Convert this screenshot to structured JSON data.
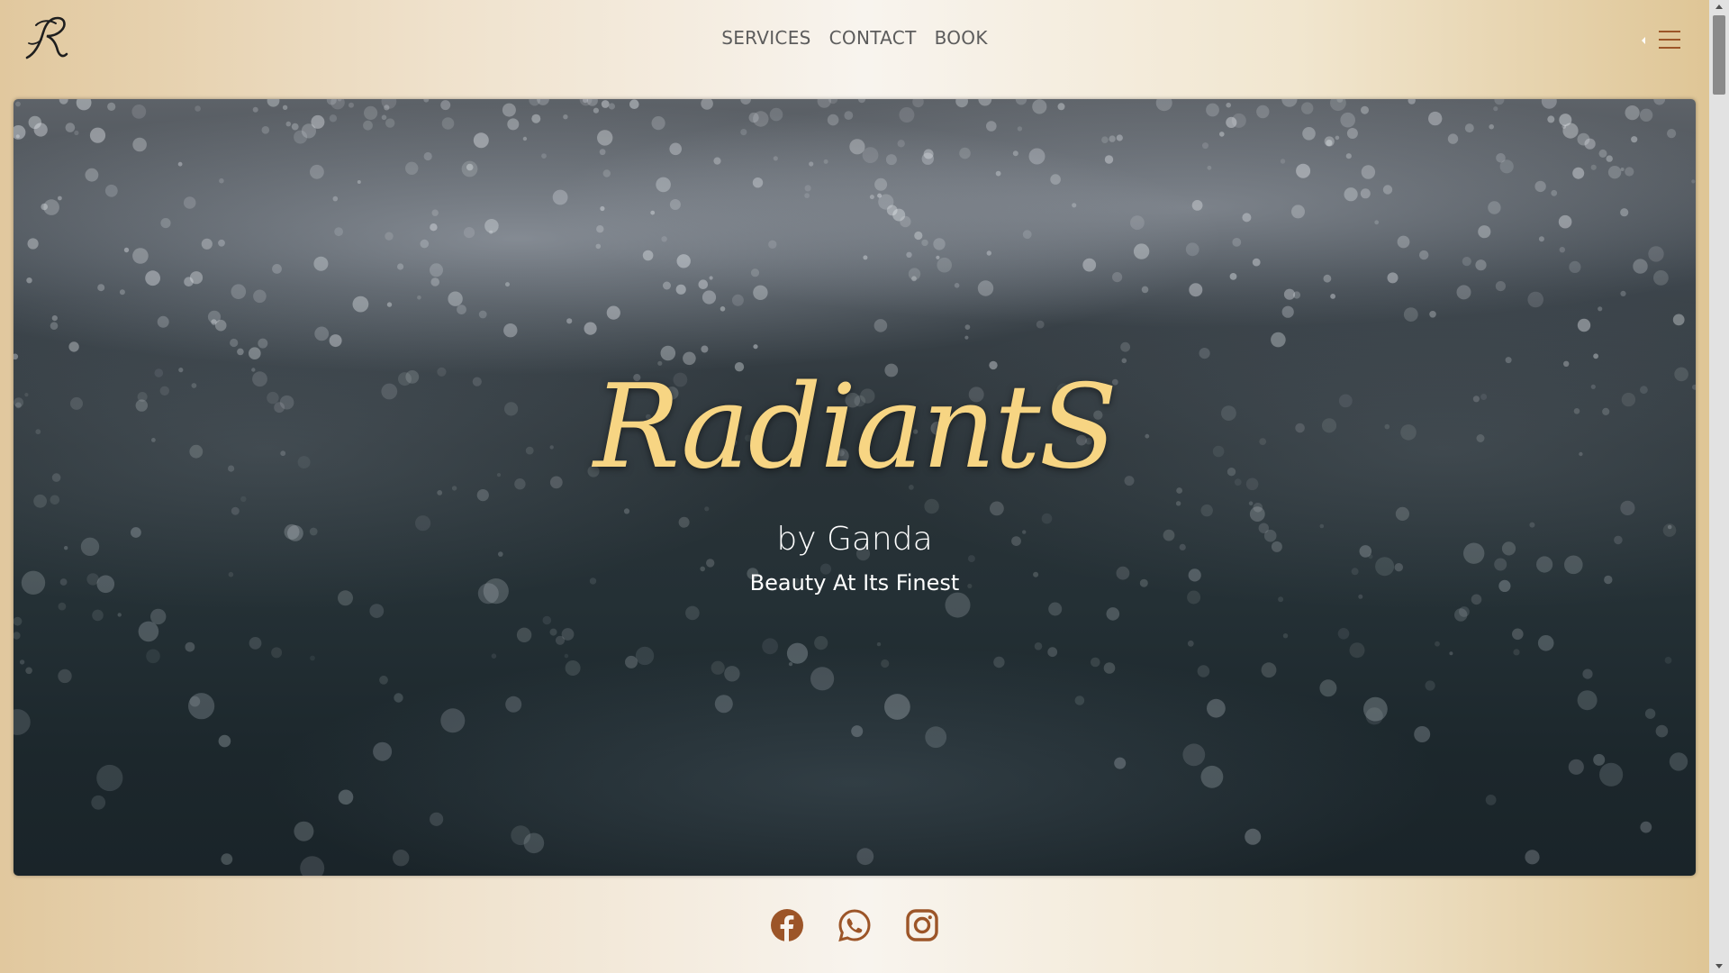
{
  "header": {
    "logo_letter": "R",
    "nav": [
      {
        "label": "SERVICES"
      },
      {
        "label": "CONTACT"
      },
      {
        "label": "BOOK"
      }
    ],
    "menu_icon": "hamburger-icon"
  },
  "hero": {
    "title": "RadiantS",
    "subtitle": "by Ganda",
    "tagline": "Beauty At Its Finest"
  },
  "social": [
    {
      "icon": "facebook-icon"
    },
    {
      "icon": "whatsapp-icon"
    },
    {
      "icon": "instagram-icon"
    }
  ],
  "colors": {
    "accent_gold": "#f7d583",
    "icon_brown": "#9c5528",
    "nav_text": "#5c5c5c"
  }
}
